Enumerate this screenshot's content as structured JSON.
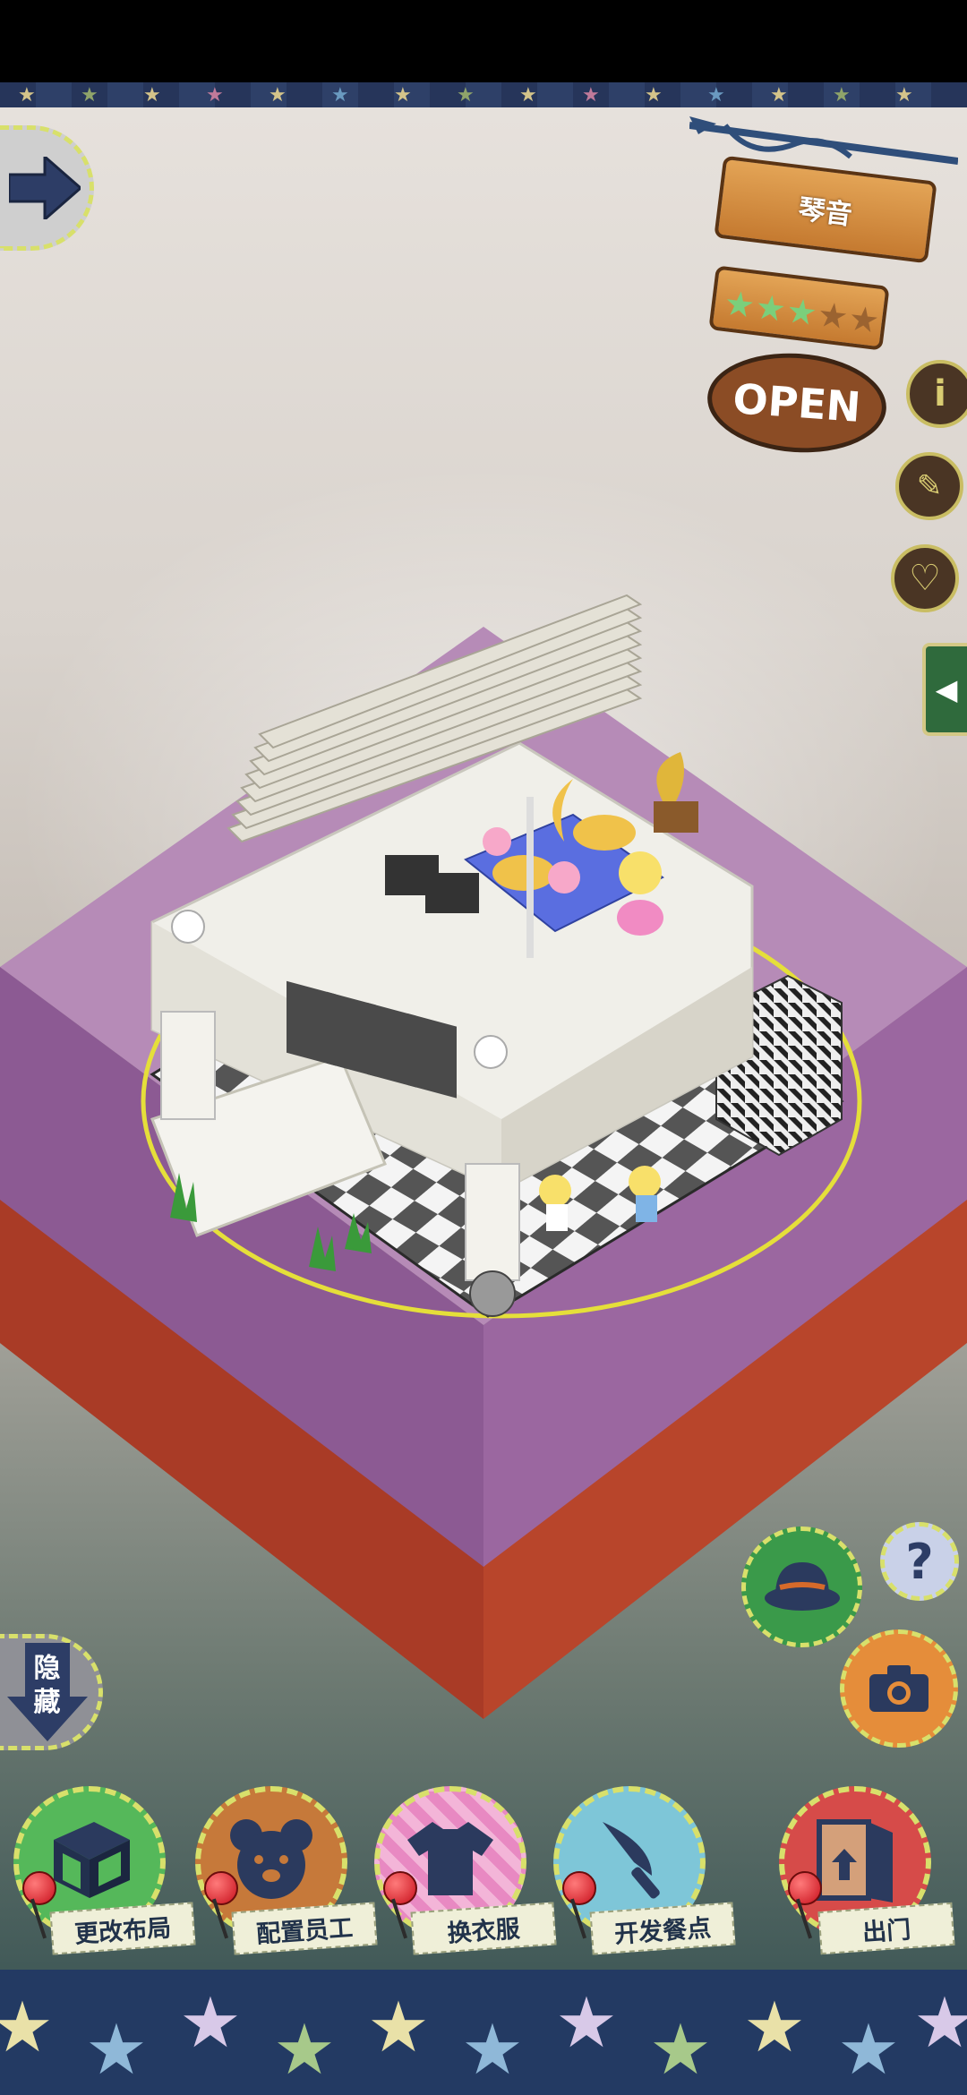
{
  "shop": {
    "name": "琴音",
    "stars_filled": 3,
    "stars_total": 5,
    "status": "OPEN"
  },
  "side_icons": {
    "info": "i",
    "recipe": "recipe-book-icon",
    "favorite": "heart-icon"
  },
  "hide_button": {
    "line1": "隐",
    "line2": "藏"
  },
  "help_button": "?",
  "actions": [
    {
      "label": "更改布局",
      "icon": "table-icon",
      "color": "#55b85a"
    },
    {
      "label": "配置员工",
      "icon": "bear-head-icon",
      "color": "#c6793a"
    },
    {
      "label": "换衣服",
      "icon": "tshirt-icon",
      "color": "#e889c2"
    },
    {
      "label": "开发餐点",
      "icon": "knife-icon",
      "color": "#7ec6d8"
    },
    {
      "label": "出门",
      "icon": "exit-door-icon",
      "color": "#d64b49"
    }
  ],
  "colors": {
    "accent_yellow": "#d8e06b",
    "platform_purple": "#a06aa6",
    "platform_red": "#c24a2c",
    "wood": "#d98e43"
  }
}
